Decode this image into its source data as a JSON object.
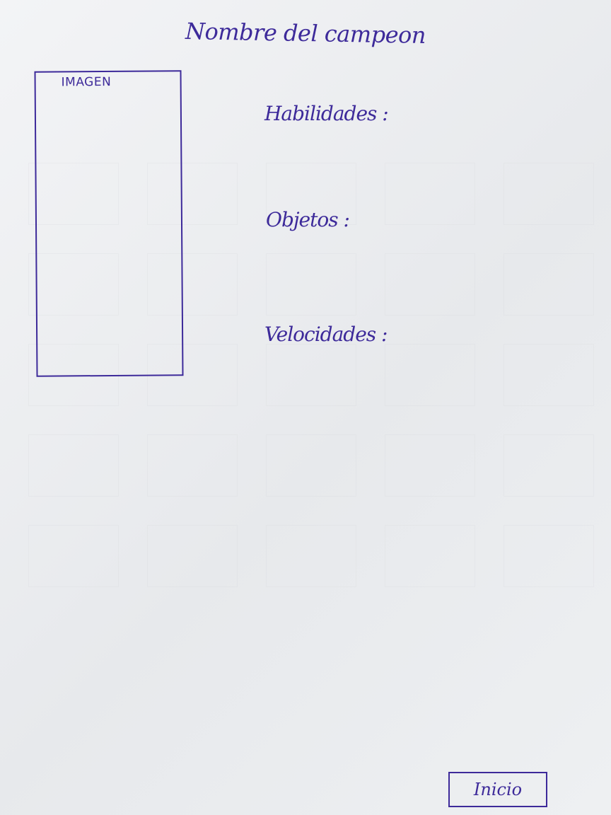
{
  "header": {
    "title": "Nombre del campeon"
  },
  "image_panel": {
    "label": "IMAGEN"
  },
  "fields": {
    "skills_label": "Habilidades :",
    "items_label": "Objetos :",
    "speed_label": "Velocidades :"
  },
  "footer": {
    "home_label": "Inicio"
  },
  "colors": {
    "ink": "#3d2a9a",
    "paper": "#eceef0"
  }
}
